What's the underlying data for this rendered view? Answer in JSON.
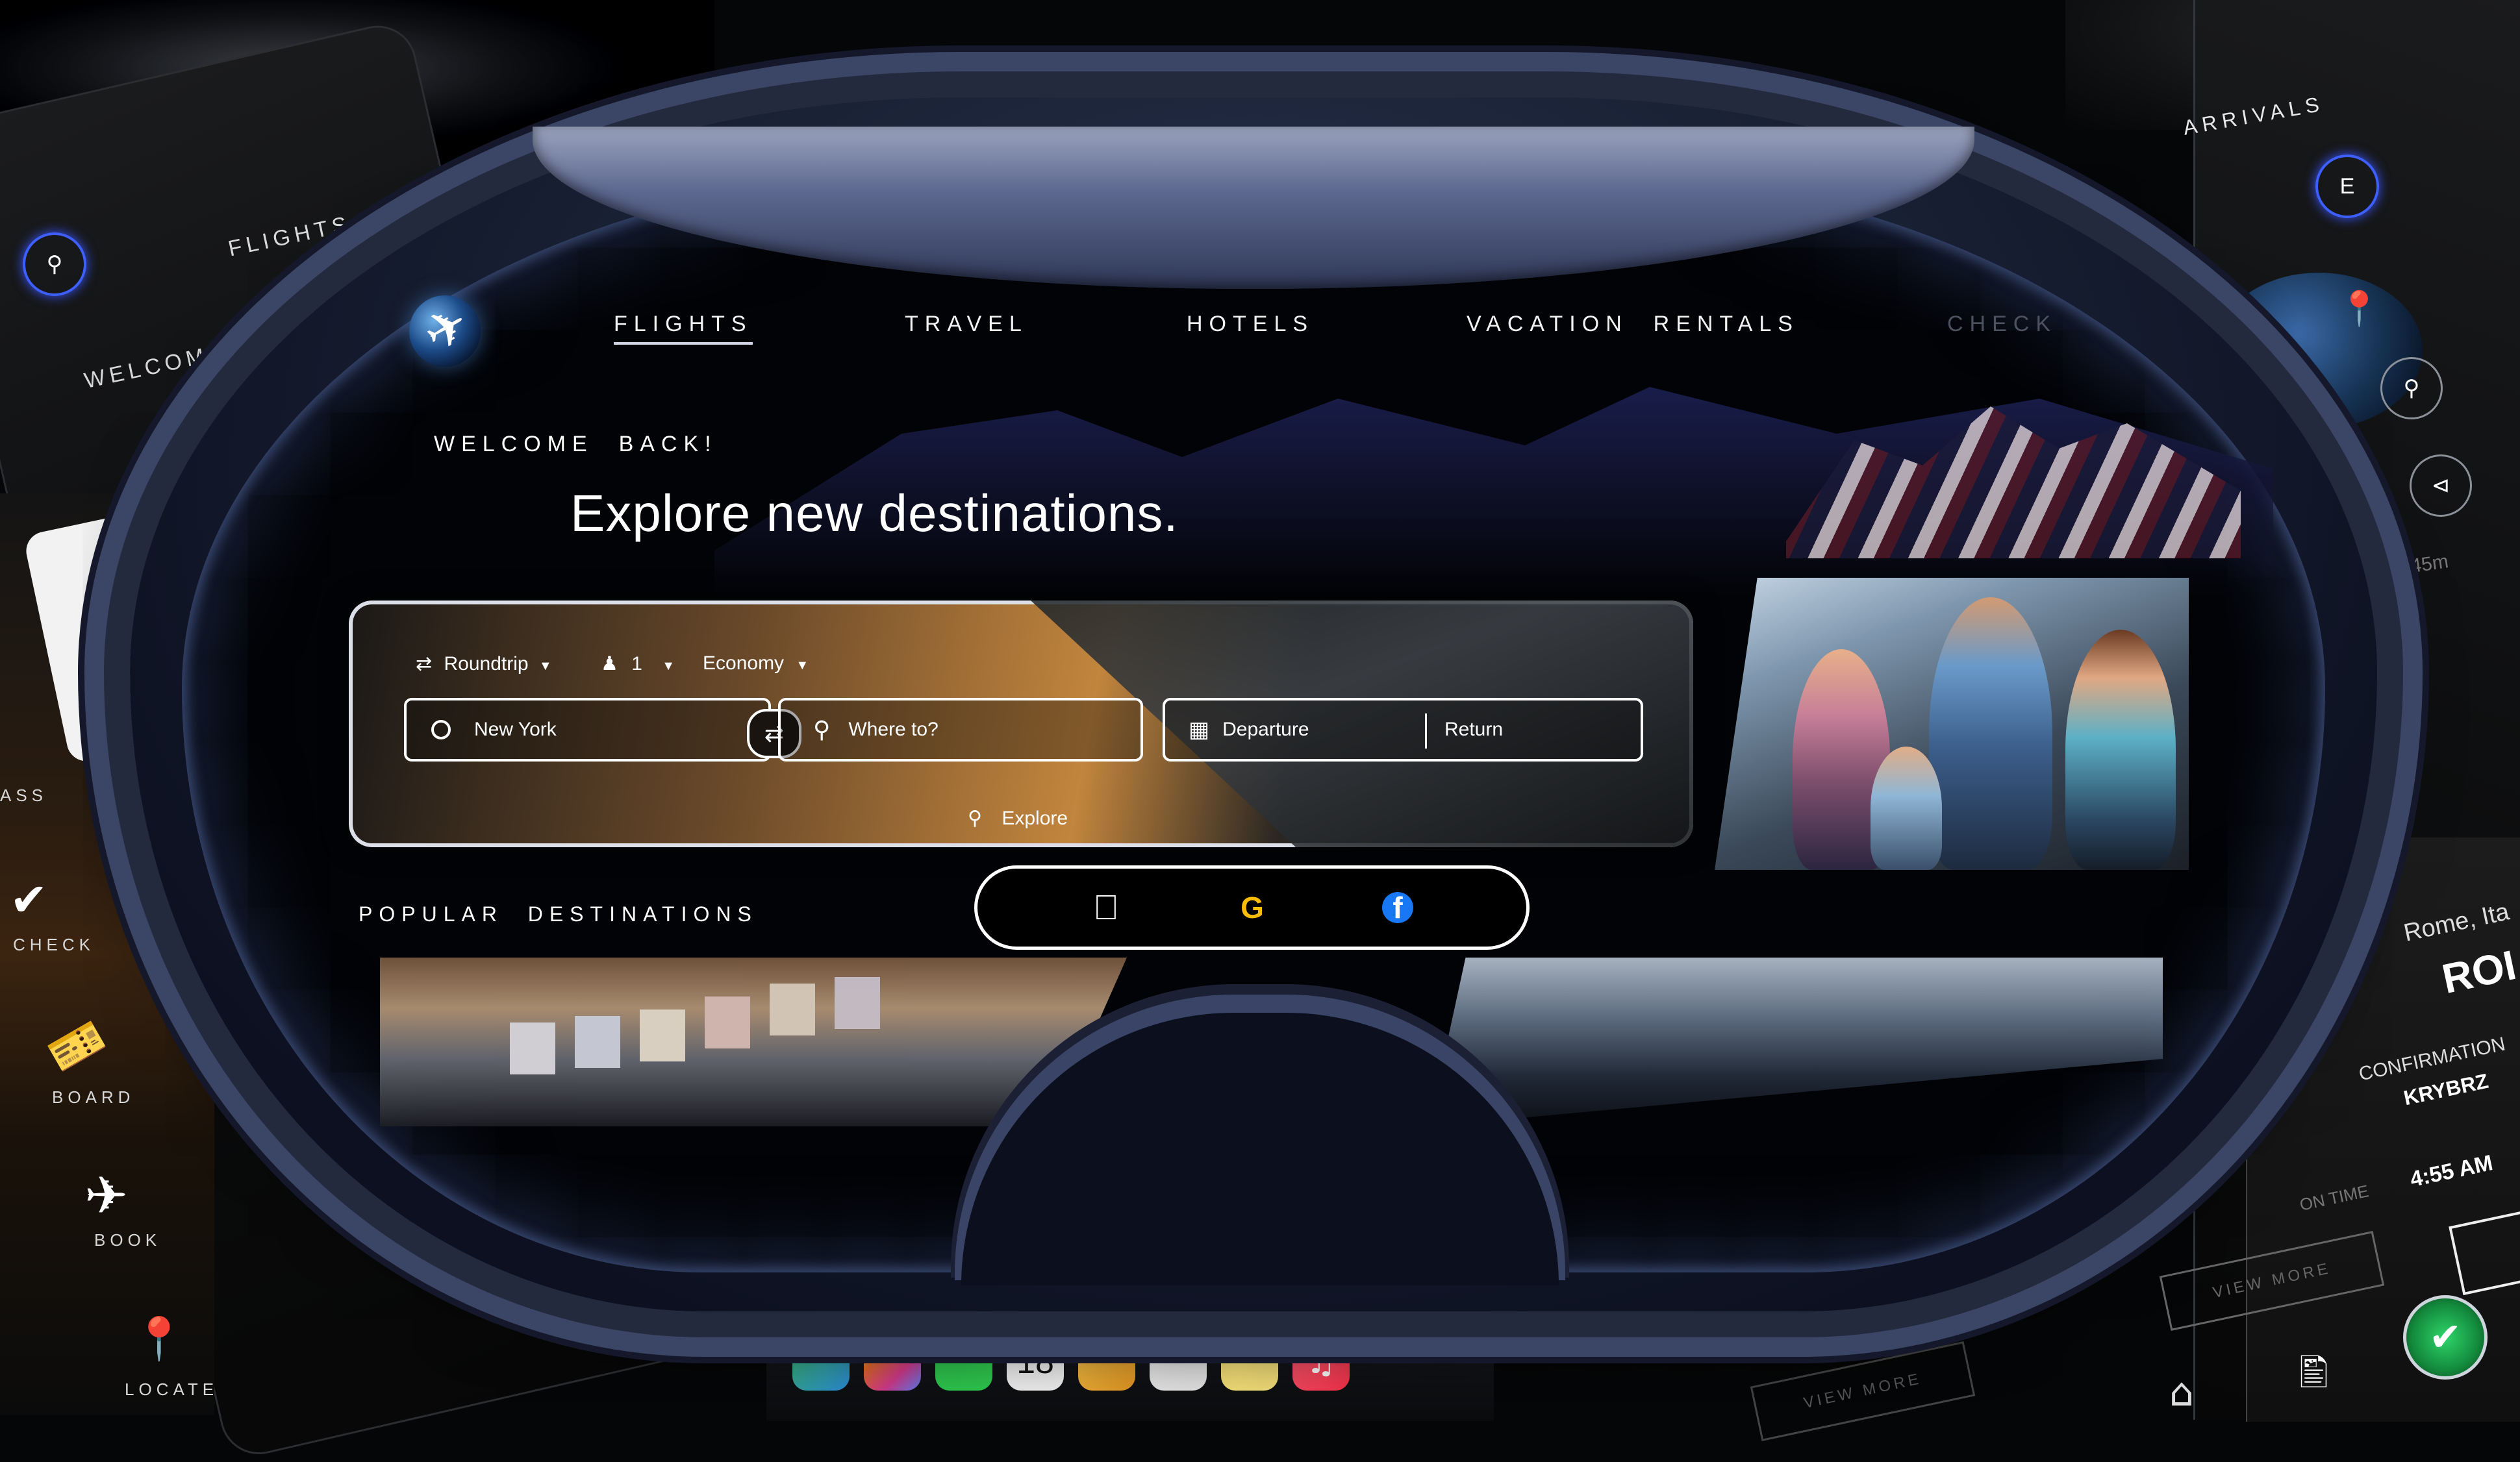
{
  "nav": {
    "items": [
      "FLIGHTS",
      "TRAVEL",
      "HOTELS",
      "VACATION  RENTALS",
      "CHECK"
    ]
  },
  "hero": {
    "welcome": "WELCOME  BACK!",
    "headline": "Explore new destinations."
  },
  "search": {
    "trip_type": "Roundtrip",
    "passengers": "1",
    "cabin": "Economy",
    "origin": "New York",
    "destination_placeholder": "Where to?",
    "departure_label": "Departure",
    "return_label": "Return",
    "explore_label": "Explore"
  },
  "social": {
    "google_letter": "G",
    "facebook_letter": "f"
  },
  "popular": {
    "title": "POPULAR  DESTINATIONS"
  },
  "left_sidebar": {
    "flights_label": "FLIGHTS",
    "welcome_label": "WELCOME",
    "pass_label": "ASS",
    "check_label": "CHECK",
    "board_label": "BOARD",
    "book_label": "BOOK",
    "locate_label": "LOCATE"
  },
  "right_panel": {
    "arrivals": "ARRIVALS",
    "badge_letter": "E",
    "duration": "9h 45m",
    "city": "Rome, Ita",
    "city_code": "ROI",
    "confirmation_label": "CONFIRMATION",
    "confirmation_code": "KRYBRZ",
    "status": "ON TIME",
    "time": "4:55 AM",
    "view_more": "VIEW MORE",
    "view_more_2": "VIEW MORE"
  },
  "dock": {
    "calendar_date": "18"
  },
  "colors": {
    "accent_ring": "#3e5fff",
    "headset_frame": "#3b4666",
    "search_panel_warm": "#c2853d",
    "check_green": "#22c55e"
  }
}
